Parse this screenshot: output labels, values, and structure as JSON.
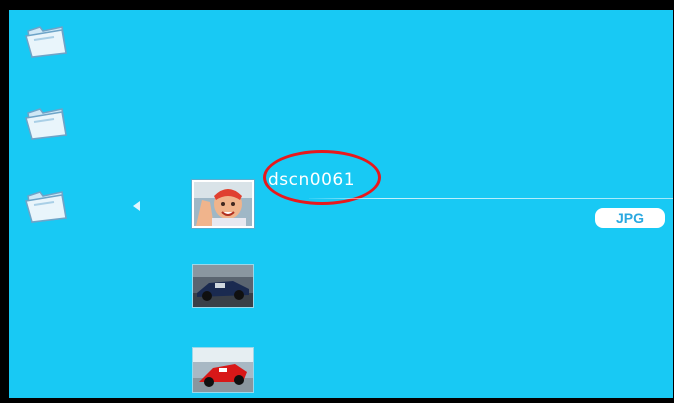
{
  "folders": [
    {
      "icon": "folder-icon"
    },
    {
      "icon": "folder-icon"
    },
    {
      "icon": "folder-icon"
    }
  ],
  "nav": {
    "left_arrow_icon": "left-arrow-icon"
  },
  "thumbnails": [
    {
      "name": "dscn0061",
      "selected": true,
      "subject": "child-photo"
    },
    {
      "selected": false,
      "subject": "race-car-dark"
    },
    {
      "selected": false,
      "subject": "race-car-red"
    }
  ],
  "selected_file": {
    "name": "dscn0061",
    "type_badge": "JPG"
  },
  "colors": {
    "background": "#18c9f4",
    "frame": "#000000",
    "highlight_ellipse": "#e8181c",
    "badge_text": "#29a8e0"
  }
}
